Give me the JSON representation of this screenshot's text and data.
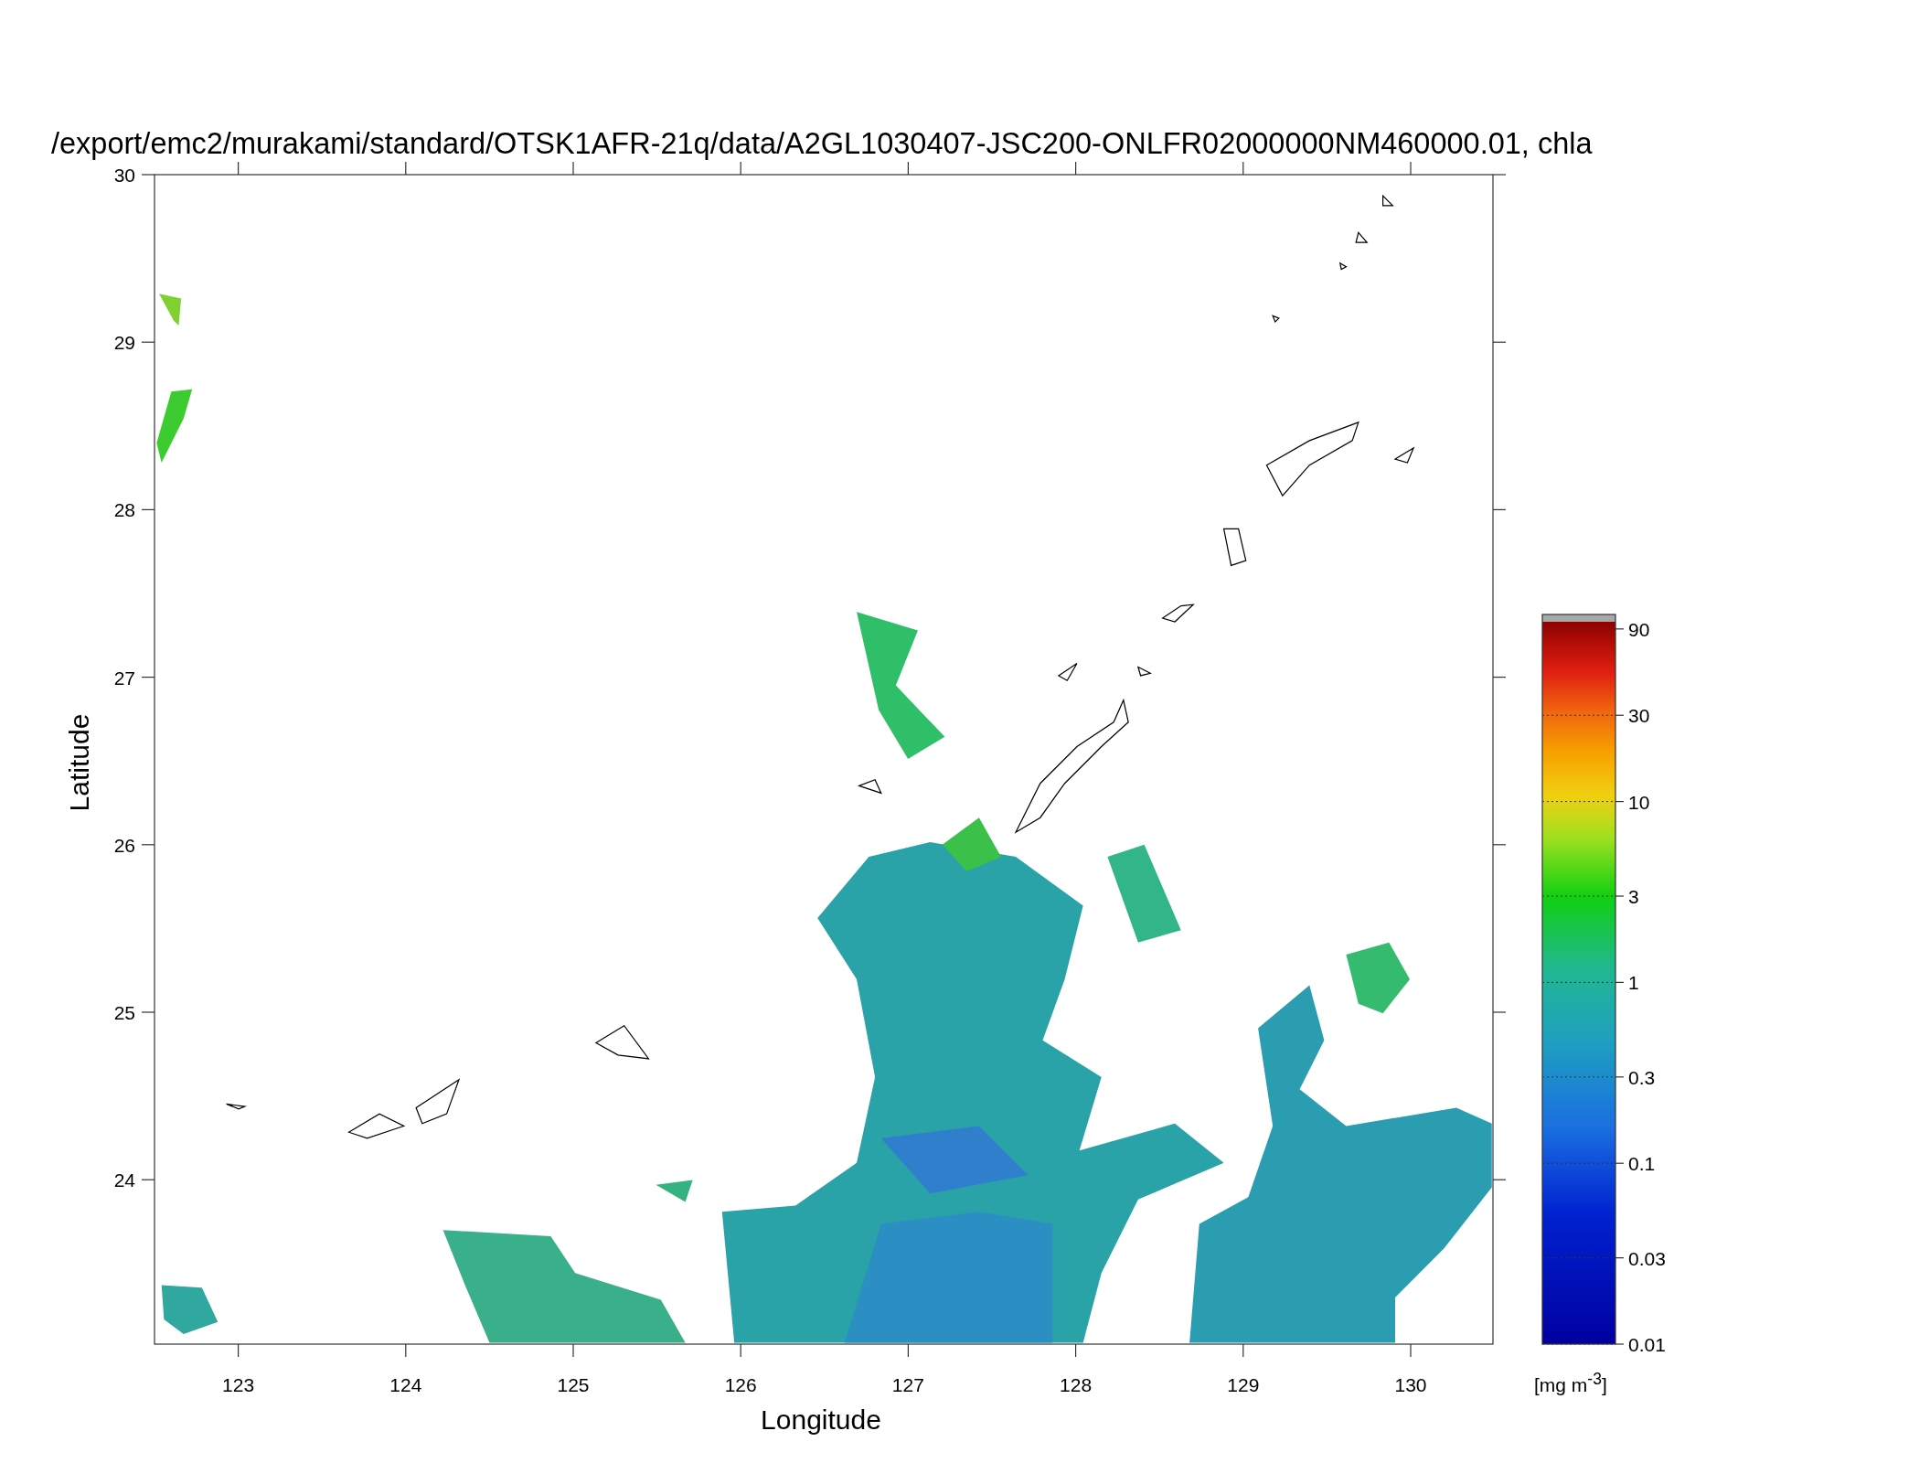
{
  "title": "/export/emc2/murakami/standard/OTSK1AFR-21q/data/A2GL1030407-JSC200-ONLFR02000000NM460000.01, chla",
  "map": {
    "xlabel": "Longitude",
    "ylabel": "Latitude",
    "xticks": [
      "123",
      "124",
      "125",
      "126",
      "127",
      "128",
      "129",
      "130"
    ],
    "yticks": [
      "30",
      "29",
      "28",
      "27",
      "26",
      "25",
      "24"
    ]
  },
  "colorbar": {
    "ticks": [
      "90",
      "30",
      "10",
      "3",
      "1",
      "0.3",
      "0.1",
      "0.03",
      "0.01"
    ],
    "units": "[mg m$^{-3}$]"
  }
}
